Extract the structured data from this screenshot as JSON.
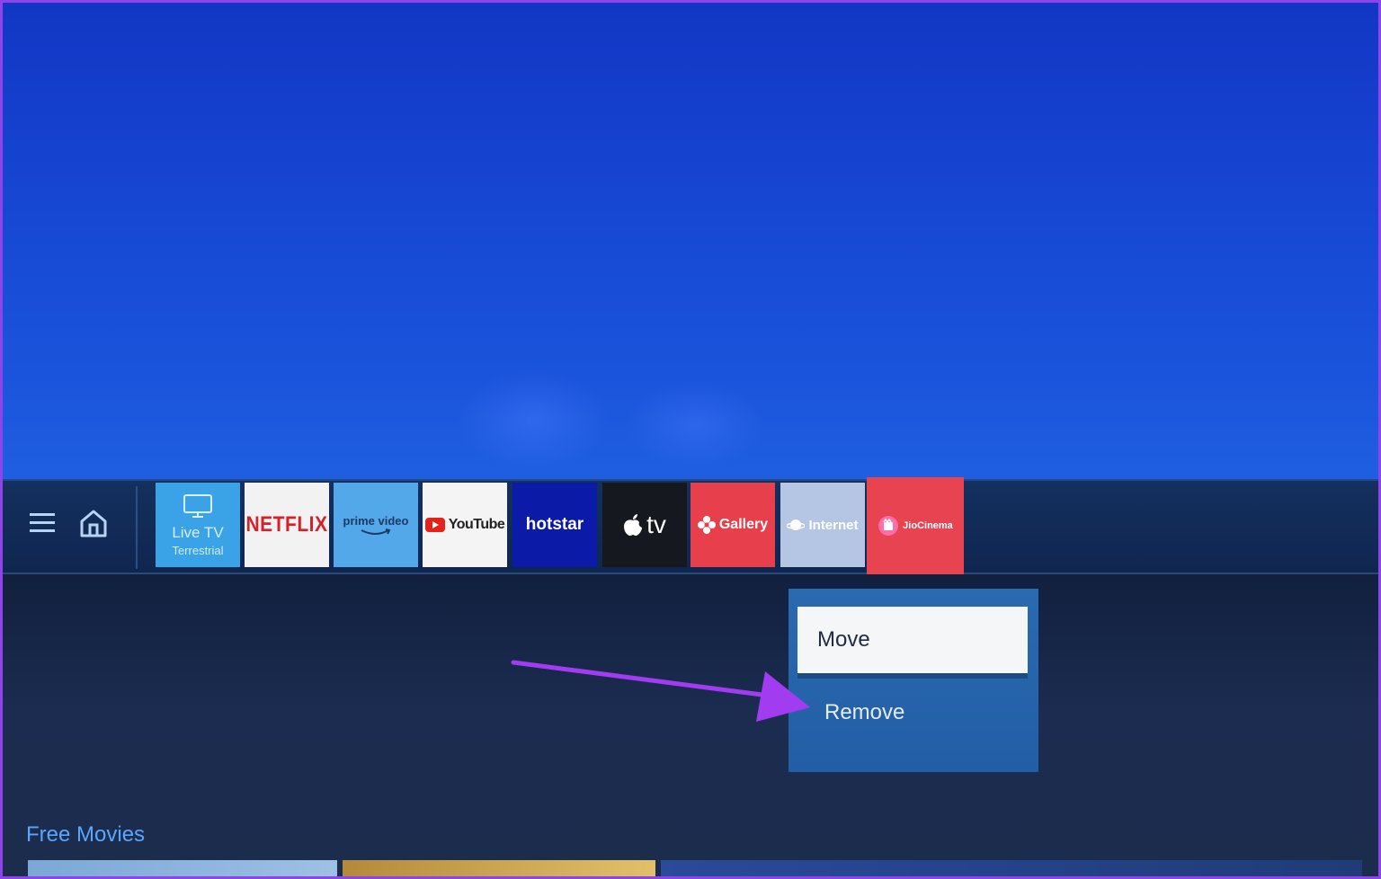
{
  "apps_bar": {
    "menu_icon": "hamburger-menu-icon",
    "home_icon": "home-icon",
    "apps": [
      {
        "id": "live-tv",
        "label": "Live TV",
        "sublabel": "Terrestrial",
        "bg": "#3aa2e6"
      },
      {
        "id": "netflix",
        "label": "NETFLIX",
        "bg": "#f2f2f2"
      },
      {
        "id": "prime-video",
        "label": "prime video",
        "bg": "#52a8e8"
      },
      {
        "id": "youtube",
        "label": "YouTube",
        "bg": "#f4f4f4"
      },
      {
        "id": "hotstar",
        "label": "hotstar",
        "bg": "#0c1aa8"
      },
      {
        "id": "apple-tv",
        "label": "tv",
        "bg": "#15191f"
      },
      {
        "id": "gallery",
        "label": "Gallery",
        "bg": "#e73f4c"
      },
      {
        "id": "internet",
        "label": "Internet",
        "bg": "#b4c6e4"
      },
      {
        "id": "jiocinema",
        "label": "JioCinema",
        "bg": "#e84350",
        "focused": true
      }
    ]
  },
  "context_menu": {
    "items": [
      {
        "label": "Move",
        "selected": true
      },
      {
        "label": "Remove",
        "selected": false
      }
    ]
  },
  "section": {
    "title": "Free Movies"
  },
  "colors": {
    "accent_arrow": "#a23cf0",
    "frame_border": "#8e44e8"
  }
}
